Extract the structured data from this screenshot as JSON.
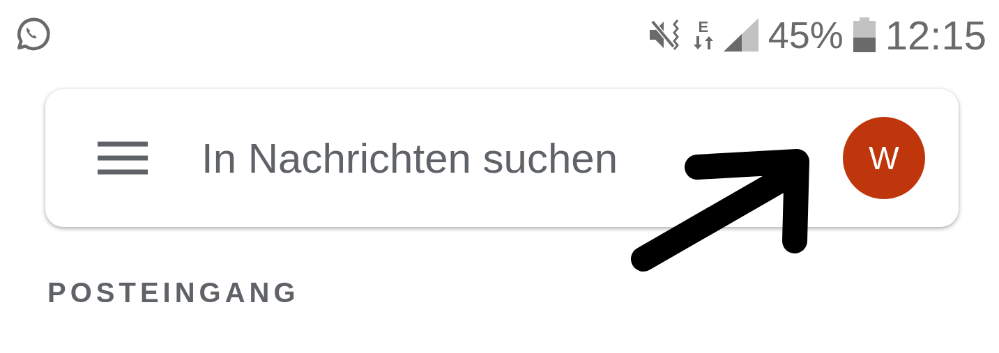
{
  "status_bar": {
    "network_type": "E",
    "battery_percent": "45%",
    "time": "12:15"
  },
  "search": {
    "placeholder": "In Nachrichten suchen",
    "avatar_initial": "W"
  },
  "section_title": "POSTEINGANG"
}
